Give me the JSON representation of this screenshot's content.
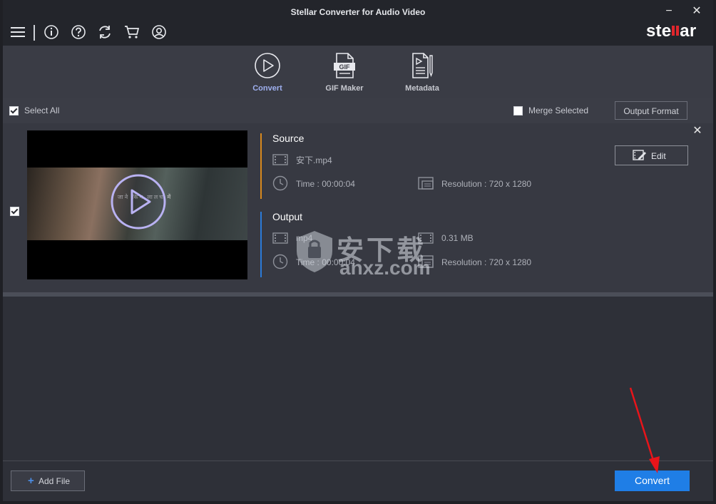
{
  "window": {
    "title": "Stellar Converter for Audio Video",
    "minimize_label": "−",
    "close_label": "✕"
  },
  "toolbar": {
    "icons": [
      "menu-icon",
      "info-icon",
      "help-icon",
      "refresh-icon",
      "cart-icon",
      "account-icon"
    ],
    "logo_text": "stellar",
    "logo_accent_color": "#e0262c"
  },
  "modes": [
    {
      "label": "Convert",
      "icon": "play-circle-icon",
      "active": true
    },
    {
      "label": "GIF Maker",
      "icon": "gif-file-icon",
      "active": false
    },
    {
      "label": "Metadata",
      "icon": "metadata-file-icon",
      "active": false
    }
  ],
  "select_bar": {
    "select_all_label": "Select All",
    "select_all_checked": true,
    "merge_label": "Merge Selected",
    "merge_checked": false,
    "output_format_label": "Output Format"
  },
  "file_item": {
    "checked": true,
    "thumbnail_subtitle": "जाने किन लालच में",
    "source": {
      "title": "Source",
      "filename": "安下.mp4",
      "time": "Time : 00:00:04",
      "resolution": "Resolution : 720 x 1280",
      "accent_color": "#d98a1e"
    },
    "output": {
      "title": "Output",
      "format": "mp4",
      "size": "0.31 MB",
      "time": "Time : 00:00:04",
      "resolution": "Resolution : 720 x 1280",
      "accent_color": "#2b7bd8"
    },
    "edit_label": "Edit",
    "close_label": "✕"
  },
  "watermark": {
    "line1": "安下载",
    "line2": "anxz.com"
  },
  "footer": {
    "add_file_label": "Add File",
    "add_file_plus": "+",
    "convert_label": "Convert",
    "convert_color": "#1f7ee6"
  }
}
